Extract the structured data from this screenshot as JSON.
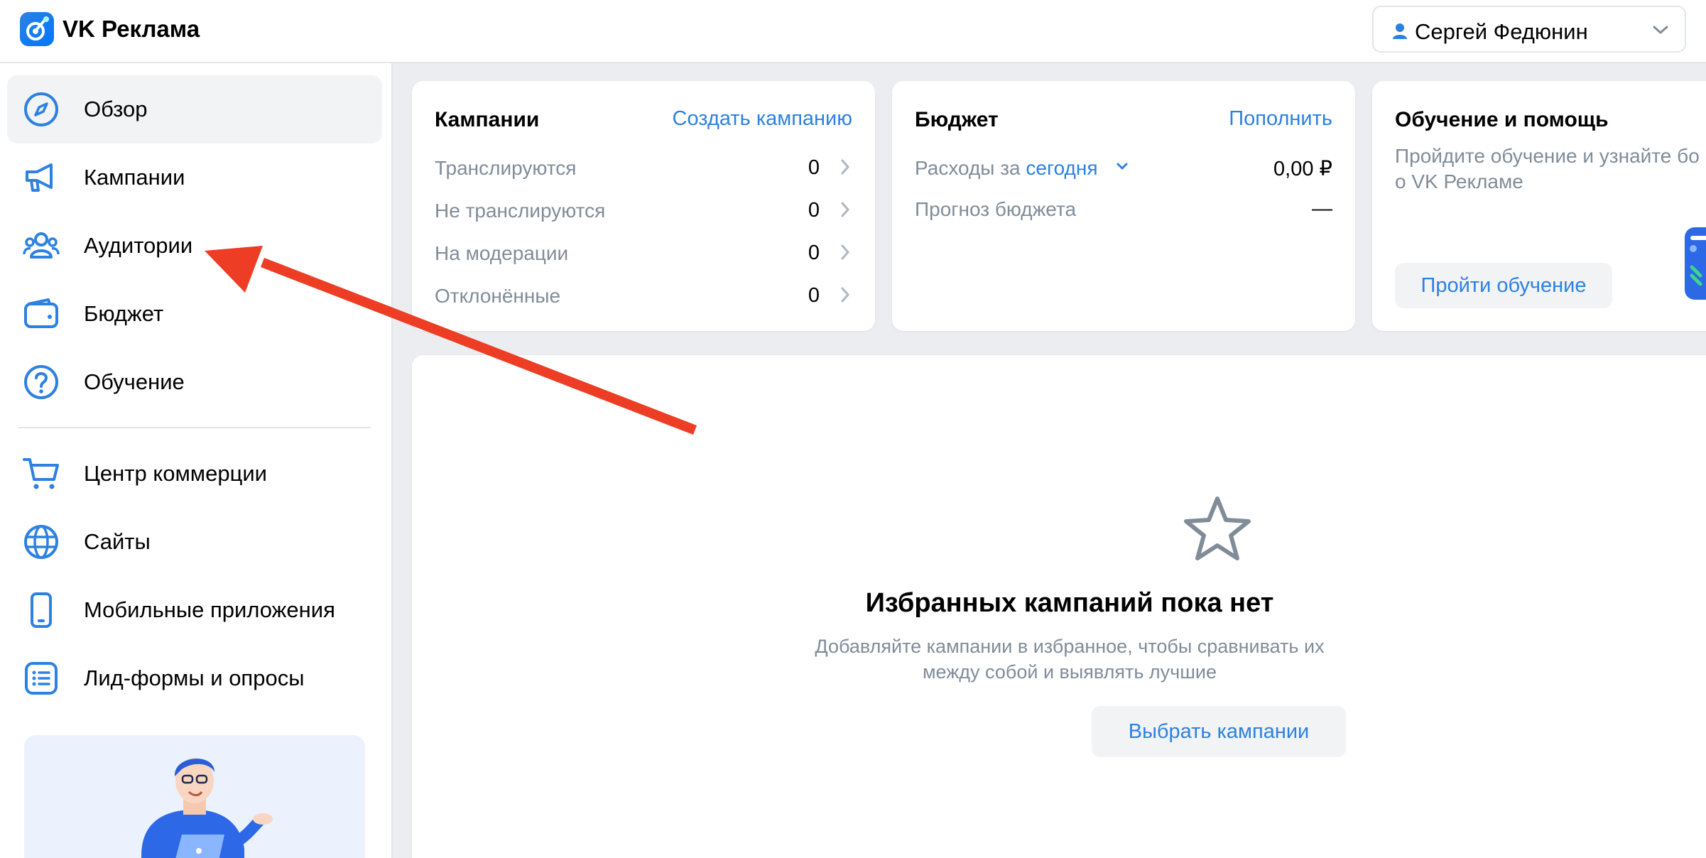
{
  "app": {
    "title": "VK Реклама",
    "accent_color": "#2d81e0",
    "annotation_color": "#ed3e25"
  },
  "header": {
    "user_name": "Сергей Федюнин",
    "user_icon": "person-icon",
    "dropdown_icon": "chevron-down-icon"
  },
  "sidebar": {
    "items": [
      {
        "label": "Обзор",
        "icon": "compass-icon",
        "active": true
      },
      {
        "label": "Кампании",
        "icon": "megaphone-icon",
        "active": false
      },
      {
        "label": "Аудитории",
        "icon": "users-icon",
        "active": false
      },
      {
        "label": "Бюджет",
        "icon": "wallet-icon",
        "active": false
      },
      {
        "label": "Обучение",
        "icon": "question-icon",
        "active": false
      },
      {
        "label": "Центр коммерции",
        "icon": "cart-icon",
        "active": false
      },
      {
        "label": "Сайты",
        "icon": "globe-icon",
        "active": false
      },
      {
        "label": "Мобильные приложения",
        "icon": "phone-icon",
        "active": false
      },
      {
        "label": "Лид-формы и опросы",
        "icon": "list-icon",
        "active": false
      }
    ]
  },
  "campaigns_card": {
    "title": "Кампании",
    "action": "Создать кампанию",
    "rows": [
      {
        "label": "Транслируются",
        "value": "0"
      },
      {
        "label": "Не транслируются",
        "value": "0"
      },
      {
        "label": "На модерации",
        "value": "0"
      },
      {
        "label": "Отклонённые",
        "value": "0"
      }
    ]
  },
  "budget_card": {
    "title": "Бюджет",
    "action": "Пополнить",
    "spend_label": "Расходы за",
    "spend_period": "сегодня",
    "spend_value": "0,00 ₽",
    "forecast_label": "Прогноз бюджета",
    "forecast_value": "—"
  },
  "help_card": {
    "title": "Обучение и помощь",
    "text_line1": "Пройдите обучение и узнайте бо",
    "text_line2": "о VK Рекламе",
    "button": "Пройти обучение"
  },
  "favorites": {
    "icon": "star-icon",
    "title": "Избранных кампаний пока нет",
    "text_line1": "Добавляйте кампании в избранное, чтобы сравнивать их",
    "text_line2": "между собой и выявлять лучшие",
    "button": "Выбрать кампании"
  }
}
